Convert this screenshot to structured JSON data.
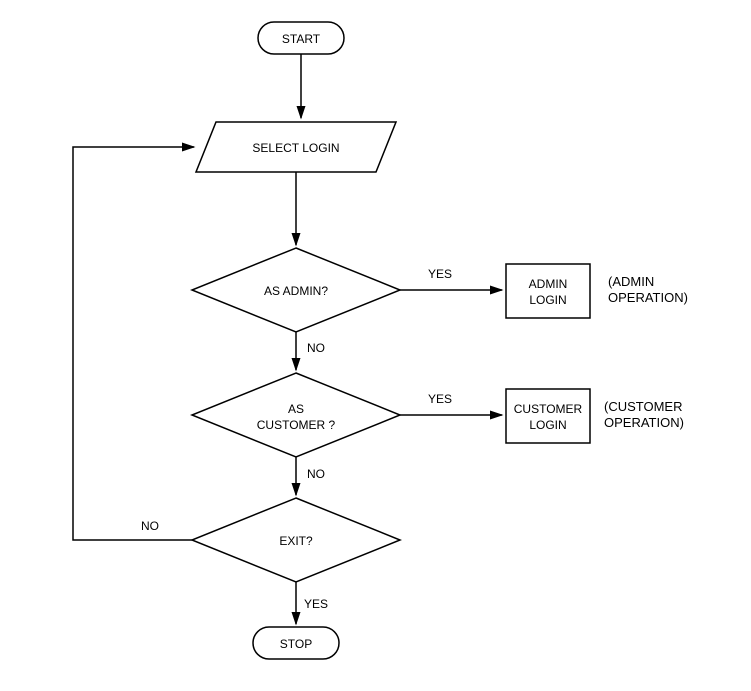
{
  "nodes": {
    "start": "START",
    "select_login": "SELECT LOGIN",
    "as_admin": "AS ADMIN?",
    "admin_login_line1": "ADMIN",
    "admin_login_line2": "LOGIN",
    "admin_side_line1": "(ADMIN",
    "admin_side_line2": "OPERATION)",
    "as_customer_line1": "AS",
    "as_customer_line2": "CUSTOMER ?",
    "customer_login_line1": "CUSTOMER",
    "customer_login_line2": "LOGIN",
    "customer_side_line1": "(CUSTOMER",
    "customer_side_line2": "OPERATION)",
    "exit": "EXIT?",
    "stop": "STOP"
  },
  "edges": {
    "yes": "YES",
    "no": "NO"
  }
}
